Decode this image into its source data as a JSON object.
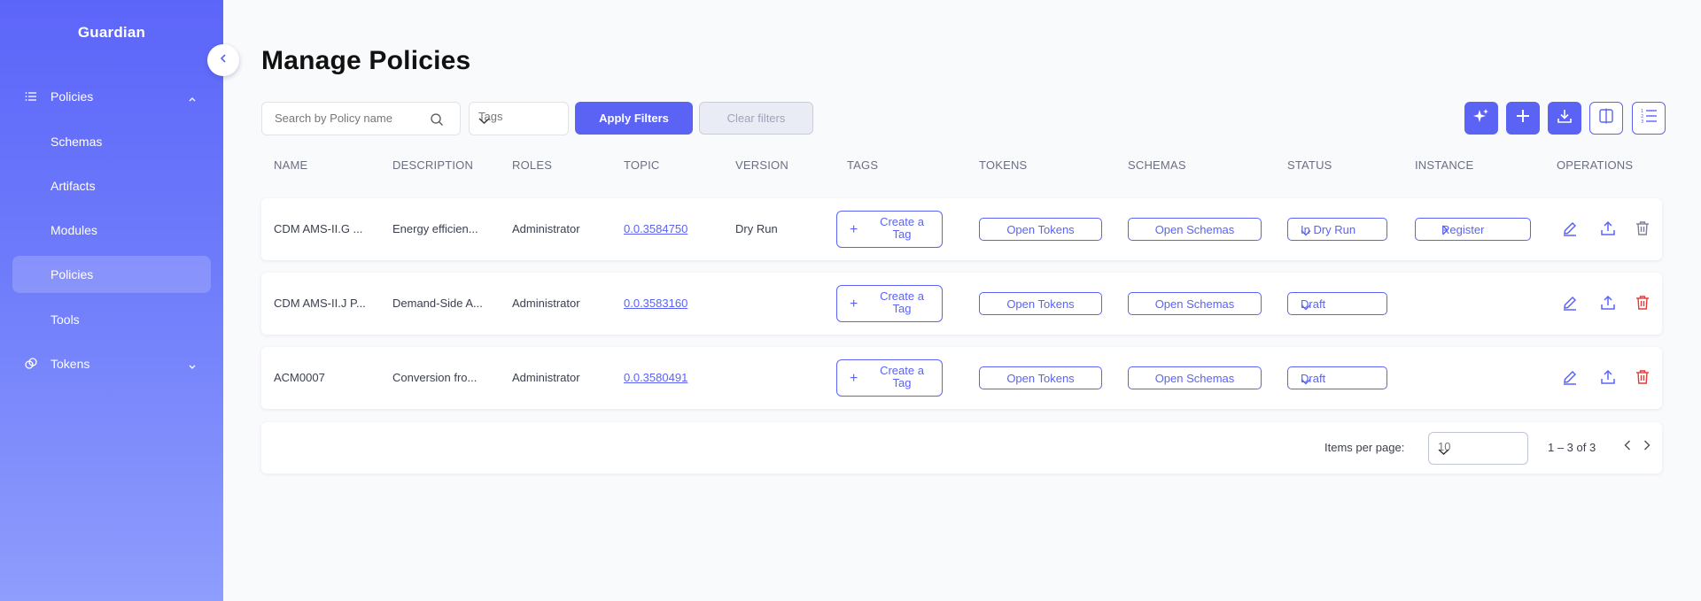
{
  "sidebar": {
    "brand": "Guardian",
    "items": [
      {
        "label": "Policies",
        "icon": "list-icon"
      },
      {
        "label": "Schemas"
      },
      {
        "label": "Artifacts"
      },
      {
        "label": "Modules"
      },
      {
        "label": "Policies"
      },
      {
        "label": "Tools"
      },
      {
        "label": "Tokens",
        "icon": "tokens-icon"
      }
    ]
  },
  "header": {
    "title": "Manage Policies"
  },
  "filters": {
    "search_placeholder": "Search by Policy name",
    "tags_placeholder": "Tags",
    "apply_label": "Apply Filters",
    "clear_label": "Clear filters"
  },
  "toolbar": {
    "icons": [
      "sparkle-icon",
      "plus-icon",
      "download-icon",
      "compare-icon",
      "ordered-list-icon"
    ]
  },
  "table": {
    "columns": [
      "NAME",
      "DESCRIPTION",
      "ROLES",
      "TOPIC",
      "VERSION",
      "TAGS",
      "TOKENS",
      "SCHEMAS",
      "STATUS",
      "INSTANCE",
      "OPERATIONS"
    ],
    "rows": [
      {
        "name": "CDM AMS-II.G ...",
        "description": "Energy efficien...",
        "roles": "Administrator",
        "topic": "0.0.3584750",
        "version": "Dry Run",
        "tag_button": "Create a Tag",
        "tokens": "Open Tokens",
        "schemas": "Open Schemas",
        "status": "In Dry Run",
        "instance": "Register",
        "delete_color": "#7c8094"
      },
      {
        "name": "CDM AMS-II.J P...",
        "description": "Demand-Side A...",
        "roles": "Administrator",
        "topic": "0.0.3583160",
        "version": "",
        "tag_button": "Create a Tag",
        "tokens": "Open Tokens",
        "schemas": "Open Schemas",
        "status": "Draft",
        "instance": "",
        "delete_color": "#e53935"
      },
      {
        "name": "ACM0007",
        "description": "Conversion fro...",
        "roles": "Administrator",
        "topic": "0.0.3580491",
        "version": "",
        "tag_button": "Create a Tag",
        "tokens": "Open Tokens",
        "schemas": "Open Schemas",
        "status": "Draft",
        "instance": "",
        "delete_color": "#e53935"
      }
    ]
  },
  "paginator": {
    "items_per_page_label": "Items per page:",
    "items_per_page": "10",
    "range": "1 – 3 of 3"
  },
  "colors": {
    "accent": "#5b63f5",
    "danger": "#e53935"
  }
}
